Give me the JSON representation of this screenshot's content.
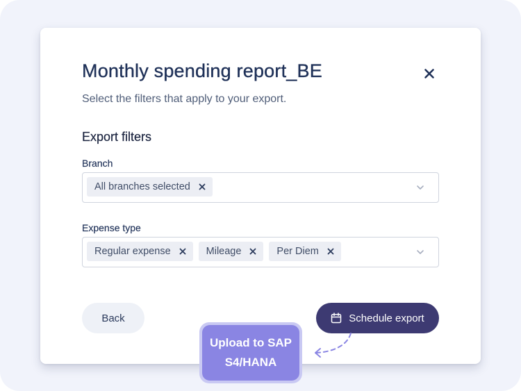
{
  "modal": {
    "title": "Monthly spending report_BE",
    "subtitle": "Select the filters that apply to your export.",
    "section_title": "Export filters"
  },
  "branch": {
    "label": "Branch",
    "chips": [
      "All branches selected"
    ]
  },
  "expense_type": {
    "label": "Expense type",
    "chips": [
      "Regular expense",
      "Mileage",
      "Per Diem"
    ]
  },
  "actions": {
    "back_label": "Back",
    "schedule_label": "Schedule export"
  },
  "callout": {
    "line1": "Upload to SAP",
    "line2": "S4/HANA"
  },
  "colors": {
    "primary": "#3d3a72",
    "title": "#1f3158",
    "callout": "#8a85e3",
    "chip_bg": "#eceef4"
  },
  "icons": [
    "close-icon",
    "chip-remove-icon",
    "chevron-down-icon",
    "calendar-icon",
    "dashed-arrow-icon"
  ]
}
